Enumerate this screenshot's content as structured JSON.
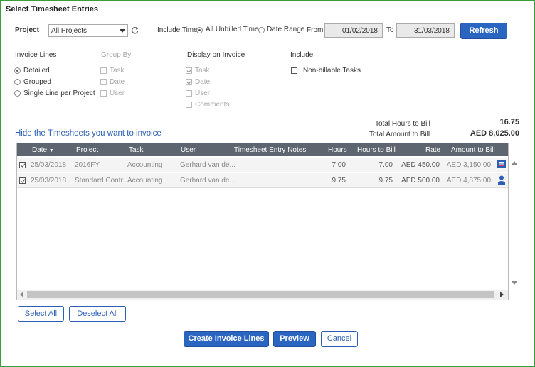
{
  "title": "Select Timesheet Entries",
  "filters": {
    "project_label": "Project",
    "project_value": "All Projects",
    "include_time_label": "Include Time",
    "all_unbilled_label": "All Unbilled Time",
    "date_range_label": "Date Range",
    "from_label": "From",
    "from_value": "01/02/2018",
    "to_label": "To",
    "to_value": "31/03/2018",
    "refresh_label": "Refresh"
  },
  "invoice_lines": {
    "header": "Invoice Lines",
    "options": [
      "Detailed",
      "Grouped",
      "Single Line per Project"
    ],
    "selected": "Detailed"
  },
  "group_by": {
    "header": "Group By",
    "options": [
      "Task",
      "Date",
      "User"
    ]
  },
  "display_on_invoice": {
    "header": "Display on Invoice",
    "options": [
      "Task",
      "Date",
      "User",
      "Comments"
    ],
    "checked": [
      "Task",
      "Date"
    ]
  },
  "include": {
    "header": "Include",
    "non_billable_label": "Non-billable Tasks"
  },
  "totals": {
    "hours_label": "Total Hours to Bill",
    "hours_value": "16.75",
    "amount_label": "Total Amount to Bill",
    "amount_value": "AED 8,025.00"
  },
  "grid_heading": "Hide the Timesheets you want to invoice",
  "grid": {
    "columns": [
      "Date",
      "Project",
      "Task",
      "User",
      "Timesheet Entry Notes",
      "Hours",
      "Hours to Bill",
      "Rate",
      "Amount to Bill"
    ],
    "rows": [
      {
        "date": "25/03/2018",
        "project": "2016FY",
        "task": "Accounting",
        "user": "Gerhard van de...",
        "notes": "",
        "hours": "7.00",
        "hours_to_bill": "7.00",
        "rate": "AED 450.00",
        "amount": "AED 3,150.00"
      },
      {
        "date": "25/03/2018",
        "project": "Standard Contr...",
        "task": "Accounting",
        "user": "Gerhard van de...",
        "notes": "",
        "hours": "9.75",
        "hours_to_bill": "9.75",
        "rate": "AED 500.00",
        "amount": "AED 4,875.00"
      }
    ]
  },
  "buttons": {
    "select_all": "Select All",
    "deselect_all": "Deselect All",
    "create_invoice_lines": "Create Invoice Lines",
    "preview": "Preview",
    "cancel": "Cancel"
  },
  "colors": {
    "border": "#3a9c3a",
    "primary": "#2b65c2",
    "header_bg": "#5c6570",
    "link": "#2b5fb5"
  }
}
